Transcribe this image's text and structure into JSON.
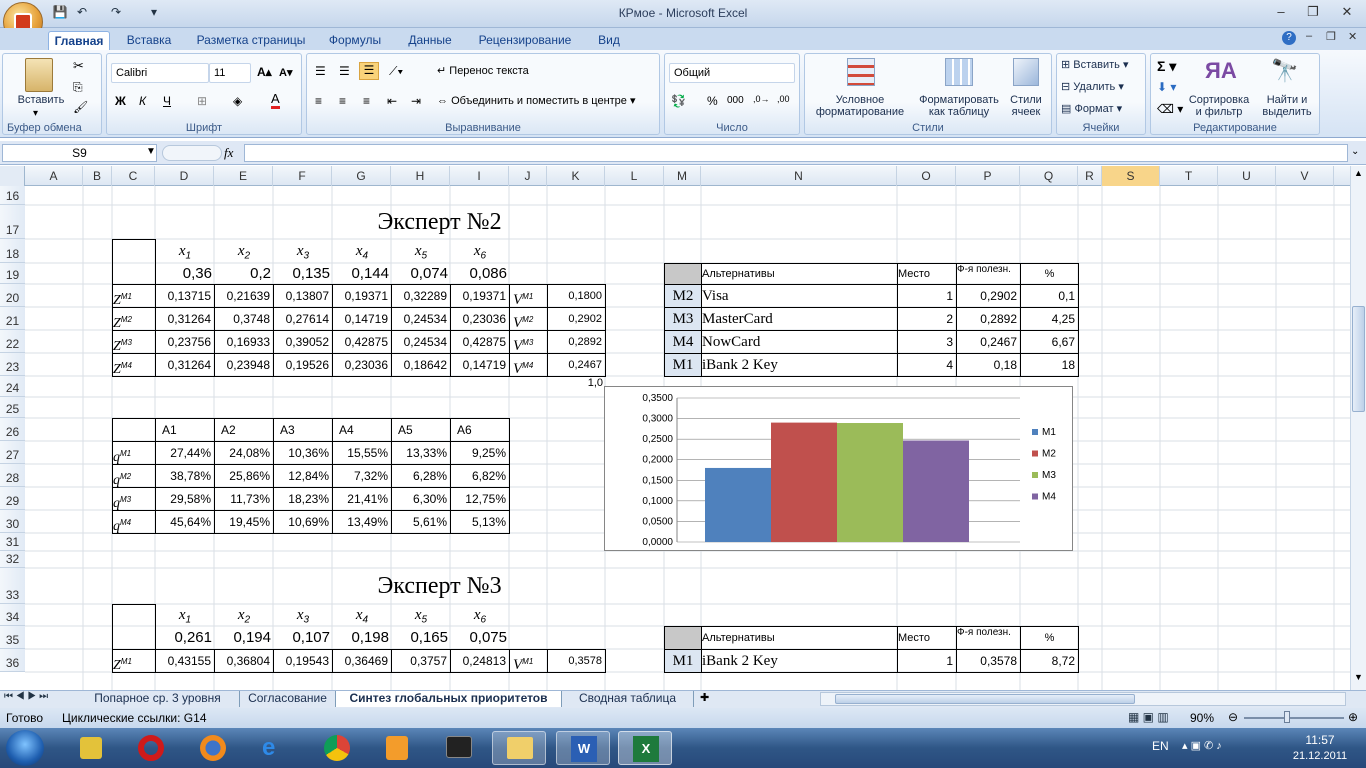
{
  "window": {
    "title": "КРмое - Microsoft Excel"
  },
  "ribbon": {
    "tabs": [
      "Главная",
      "Вставка",
      "Разметка страницы",
      "Формулы",
      "Данные",
      "Рецензирование",
      "Вид"
    ],
    "clipboard": {
      "label": "Буфер обмена",
      "paste": "Вставить"
    },
    "font": {
      "label": "Шрифт",
      "name": "Calibri",
      "size": "11"
    },
    "align": {
      "label": "Выравнивание",
      "wrap": "Перенос текста",
      "merge": "Объединить и поместить в центре"
    },
    "number": {
      "label": "Число",
      "format": "Общий"
    },
    "styles": {
      "label": "Стили",
      "cond1": "Условное",
      "cond2": "форматирование",
      "table1": "Форматировать",
      "table2": "как таблицу",
      "cell1": "Стили",
      "cell2": "ячеек"
    },
    "cells": {
      "label": "Ячейки",
      "insert": "Вставить",
      "delete": "Удалить",
      "format": "Формат"
    },
    "edit": {
      "label": "Редактирование",
      "sort1": "Сортировка",
      "sort2": "и фильтр",
      "find1": "Найти и",
      "find2": "выделить"
    }
  },
  "formula": {
    "namebox": "S9",
    "fx": "fx",
    "value": ""
  },
  "columns": [
    "A",
    "B",
    "C",
    "D",
    "E",
    "F",
    "G",
    "H",
    "I",
    "J",
    "K",
    "L",
    "M",
    "N",
    "O",
    "P",
    "Q",
    "R",
    "S",
    "T",
    "U",
    "V"
  ],
  "rows": [
    "16",
    "17",
    "18",
    "19",
    "20",
    "21",
    "22",
    "23",
    "24",
    "25",
    "26",
    "27",
    "28",
    "29",
    "30",
    "31",
    "32",
    "33",
    "34",
    "35",
    "36"
  ],
  "expert2": {
    "title": "Эксперт №2",
    "x_labels": [
      "x",
      "x",
      "x",
      "x",
      "x",
      "x"
    ],
    "x_subs": [
      "1",
      "2",
      "3",
      "4",
      "5",
      "6"
    ],
    "weights": [
      "0,36",
      "0,2",
      "0,135",
      "0,144",
      "0,074",
      "0,086"
    ],
    "z_rows": [
      {
        "label": "Z",
        "sup": "M1",
        "vals": [
          "0,13715",
          "0,21639",
          "0,13807",
          "0,19371",
          "0,32289",
          "0,19371"
        ],
        "v_sup": "M1",
        "v": "0,1800"
      },
      {
        "label": "Z",
        "sup": "M2",
        "vals": [
          "0,31264",
          "0,3748",
          "0,27614",
          "0,14719",
          "0,24534",
          "0,23036"
        ],
        "v_sup": "M2",
        "v": "0,2902"
      },
      {
        "label": "Z",
        "sup": "M3",
        "vals": [
          "0,23756",
          "0,16933",
          "0,39052",
          "0,42875",
          "0,24534",
          "0,42875"
        ],
        "v_sup": "M3",
        "v": "0,2892"
      },
      {
        "label": "Z",
        "sup": "M4",
        "vals": [
          "0,31264",
          "0,23948",
          "0,19526",
          "0,23036",
          "0,18642",
          "0,14719"
        ],
        "v_sup": "M4",
        "v": "0,2467"
      }
    ],
    "a_headers": [
      "A1",
      "A2",
      "A3",
      "A4",
      "A5",
      "A6"
    ],
    "q_rows": [
      {
        "label": "q",
        "sup": "M1",
        "vals": [
          "27,44%",
          "24,08%",
          "10,36%",
          "15,55%",
          "13,33%",
          "9,25%"
        ]
      },
      {
        "label": "q",
        "sup": "M2",
        "vals": [
          "38,78%",
          "25,86%",
          "12,84%",
          "7,32%",
          "6,28%",
          "6,82%"
        ]
      },
      {
        "label": "q",
        "sup": "M3",
        "vals": [
          "29,58%",
          "11,73%",
          "18,23%",
          "21,41%",
          "6,30%",
          "12,75%"
        ]
      },
      {
        "label": "q",
        "sup": "M4",
        "vals": [
          "45,64%",
          "19,45%",
          "10,69%",
          "13,49%",
          "5,61%",
          "5,13%"
        ]
      }
    ],
    "rank_headers": [
      "Альтернативы",
      "Место",
      "Ф-я полезн.",
      "%"
    ],
    "rank": [
      {
        "m": "M2",
        "name": "Visa",
        "place": "1",
        "util": "0,2902",
        "pct": "0,1"
      },
      {
        "m": "M3",
        "name": "MasterCard",
        "place": "2",
        "util": "0,2892",
        "pct": "4,25"
      },
      {
        "m": "M4",
        "name": "NowCard",
        "place": "3",
        "util": "0,2467",
        "pct": "6,67"
      },
      {
        "m": "M1",
        "name": "iBank 2 Key",
        "place": "4",
        "util": "0,18",
        "pct": "18"
      }
    ],
    "stray": "1,0"
  },
  "expert3": {
    "title": "Эксперт №3",
    "weights": [
      "0,261",
      "0,194",
      "0,107",
      "0,198",
      "0,165",
      "0,075"
    ],
    "z_row": {
      "label": "Z",
      "sup": "M1",
      "vals": [
        "0,43155",
        "0,36804",
        "0,19543",
        "0,36469",
        "0,3757",
        "0,24813"
      ],
      "v_sup": "M1",
      "v": "0,3578"
    },
    "rank_headers": [
      "Альтернативы",
      "Место",
      "Ф-я полезн.",
      "%"
    ],
    "rank": [
      {
        "m": "M1",
        "name": "iBank 2 Key",
        "place": "1",
        "util": "0,3578",
        "pct": "8,72"
      }
    ]
  },
  "chart_data": {
    "type": "bar",
    "categories": [
      "M1",
      "M2",
      "M3",
      "M4"
    ],
    "values": [
      0.18,
      0.2902,
      0.2892,
      0.2467
    ],
    "colors": [
      "#4f81bd",
      "#c0504d",
      "#9bbb59",
      "#8064a2"
    ],
    "ylim": [
      0,
      0.35
    ],
    "yticks": [
      "0,0000",
      "0,0500",
      "0,1000",
      "0,1500",
      "0,2000",
      "0,2500",
      "0,3000",
      "0,3500"
    ],
    "legend": [
      "M1",
      "M2",
      "M3",
      "M4"
    ],
    "legend_position": "right",
    "grid": true
  },
  "sheets": [
    "Попарное ср. 3 уровня",
    "Согласование",
    "Синтез глобальных приоритетов",
    "Сводная таблица"
  ],
  "active_sheet": 2,
  "status": {
    "ready": "Готово",
    "cyclic": "Циклические ссылки: G14",
    "zoom": "90%"
  },
  "taskbar": {
    "lang": "EN",
    "time": "11:57",
    "date": "21.12.2011"
  }
}
